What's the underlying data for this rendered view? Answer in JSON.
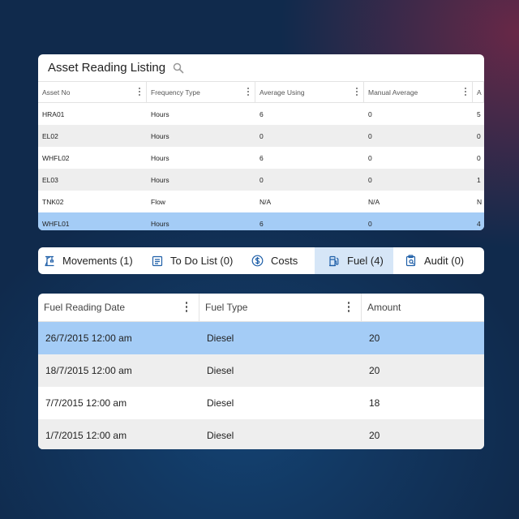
{
  "asset_listing": {
    "title": "Asset Reading Listing",
    "columns": [
      "Asset No",
      "Frequency Type",
      "Average Using",
      "Manual Average",
      "A"
    ],
    "rows": [
      {
        "asset_no": "HRA01",
        "frequency": "Hours",
        "avg_using": "6",
        "manual_avg": "0",
        "extra": "5"
      },
      {
        "asset_no": "EL02",
        "frequency": "Hours",
        "avg_using": "0",
        "manual_avg": "0",
        "extra": "0"
      },
      {
        "asset_no": "WHFL02",
        "frequency": "Hours",
        "avg_using": "6",
        "manual_avg": "0",
        "extra": "0"
      },
      {
        "asset_no": "EL03",
        "frequency": "Hours",
        "avg_using": "0",
        "manual_avg": "0",
        "extra": "1"
      },
      {
        "asset_no": "TNK02",
        "frequency": "Flow",
        "avg_using": "N/A",
        "manual_avg": "N/A",
        "extra": "N"
      },
      {
        "asset_no": "WHFL01",
        "frequency": "Hours",
        "avg_using": "6",
        "manual_avg": "0",
        "extra": "4"
      }
    ],
    "selected_row": 5
  },
  "tabs": [
    {
      "label": "Movements (1)",
      "icon": "crane-icon"
    },
    {
      "label": "To Do List (0)",
      "icon": "list-icon"
    },
    {
      "label": "Costs",
      "icon": "dollar-icon"
    },
    {
      "label": "Fuel (4)",
      "icon": "fuel-pump-icon",
      "active": true
    },
    {
      "label": "Audit (0)",
      "icon": "clipboard-search-icon"
    }
  ],
  "fuel_grid": {
    "columns": [
      "Fuel Reading Date",
      "Fuel Type",
      "Amount"
    ],
    "rows": [
      {
        "date": "26/7/2015 12:00 am",
        "type": "Diesel",
        "amount": "20"
      },
      {
        "date": "18/7/2015 12:00 am",
        "type": "Diesel",
        "amount": "20"
      },
      {
        "date": "7/7/2015 12:00 am",
        "type": "Diesel",
        "amount": "18"
      },
      {
        "date": "1/7/2015 12:00 am",
        "type": "Diesel",
        "amount": "20"
      }
    ],
    "selected_row": 0
  },
  "colors": {
    "selected_row": "#a4ccf6",
    "active_tab": "#d6e6f7",
    "icon_blue": "#1f5fa8",
    "alt_row": "#eeeeee"
  }
}
